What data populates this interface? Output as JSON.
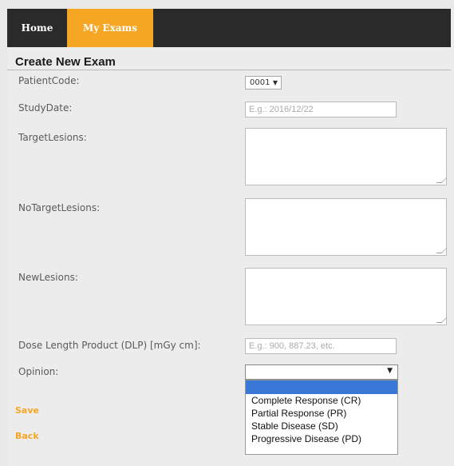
{
  "nav": {
    "home_label": "Home",
    "exams_label": "My Exams"
  },
  "form": {
    "title": "Create New Exam",
    "patient_code": {
      "label": "PatientCode:",
      "value": "0001"
    },
    "study_date": {
      "label": "StudyDate:",
      "placeholder": "E.g.: 2016/12/22"
    },
    "target_lesions": {
      "label": "TargetLesions:"
    },
    "no_target_lesions": {
      "label": "NoTargetLesions:"
    },
    "new_lesions": {
      "label": "NewLesions:"
    },
    "dlp": {
      "label": "Dose Length Product (DLP) [mGy cm]:",
      "placeholder": "E.g.: 900, 887.23, etc."
    },
    "opinion": {
      "label": "Opinion:",
      "value": "",
      "options": [
        "",
        "Complete Response (CR)",
        "Partial Response (PR)",
        "Stable Disease (SD)",
        "Progressive Disease (PD)"
      ]
    }
  },
  "actions": {
    "save_label": "Save",
    "back_label": "Back"
  },
  "colors": {
    "accent": "#f5a623",
    "navbar": "#2a2a2a",
    "selection": "#3a78d8"
  },
  "icons": {
    "select_arrow": "triangle-down-icon"
  }
}
